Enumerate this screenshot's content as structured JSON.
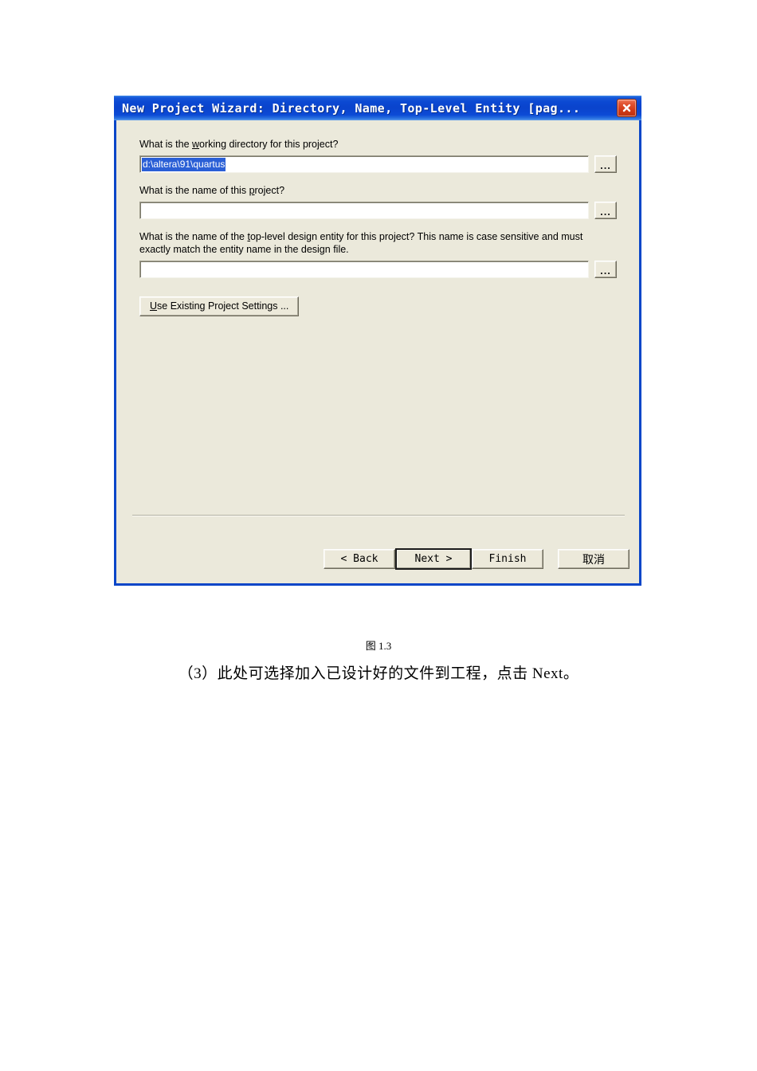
{
  "dialog": {
    "title": "New Project Wizard: Directory, Name, Top-Level Entity [pag...",
    "close_icon": "close-icon",
    "fields": [
      {
        "label_before": "What is the ",
        "label_accel": "w",
        "label_after": "orking directory for this project?",
        "full_label": "What is the working directory for this project?",
        "value": "d:\\altera\\91\\quartus",
        "selected": true,
        "browse_label": "..."
      },
      {
        "label_before": "What is the name of this ",
        "label_accel": "p",
        "label_after": "roject?",
        "full_label": "What is the name of this project?",
        "value": "",
        "selected": false,
        "browse_label": "..."
      },
      {
        "label_line1_a": "What is the name of the ",
        "label_line1_accel1": "t",
        "label_line1_b": "op-level desi",
        "label_line1_accel2": "g",
        "label_line1_c": "n entity for this project? This name is case sensitive and must",
        "label_line2": "exactly match the entity name in the design file.",
        "value": "",
        "selected": false,
        "browse_label": "..."
      }
    ],
    "use_existing": {
      "accel": "U",
      "rest": "se Existing Project Settings ...",
      "full_label": "Use Existing Project Settings ..."
    },
    "buttons": [
      {
        "label": "< Back",
        "name": "back-button",
        "default": false
      },
      {
        "label": "Next >",
        "name": "next-button",
        "default": true
      },
      {
        "label": "Finish",
        "name": "finish-button",
        "default": false
      },
      {
        "label": "取消",
        "name": "cancel-button",
        "default": false
      }
    ]
  },
  "document": {
    "figure_caption": "图 1.3",
    "paragraph": "（3）此处可选择加入已设计好的文件到工程，点击 Next。"
  },
  "colors": {
    "titlebar_blue": "#0a46c8",
    "dialog_face": "#ebe9db",
    "selection_blue": "#2a5fd6",
    "close_red": "#d33a17",
    "page_background": "#ffffff"
  }
}
